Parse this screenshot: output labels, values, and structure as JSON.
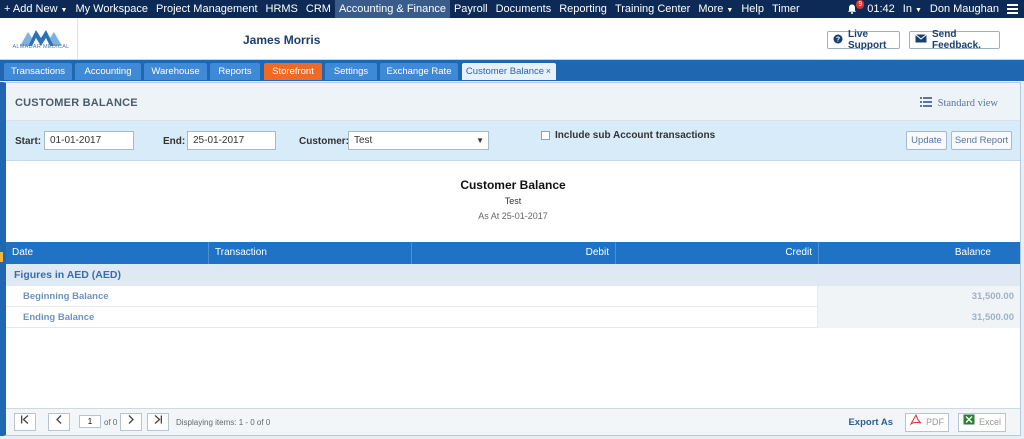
{
  "topnav": {
    "items": [
      "+ Add New",
      "My Workspace",
      "Project Management",
      "HRMS",
      "CRM",
      "Accounting & Finance",
      "Payroll",
      "Documents",
      "Reporting",
      "Training Center",
      "More",
      "Help",
      "Timer"
    ],
    "notification_count": "9",
    "time": "01:42",
    "status": "In",
    "user": "Don Maughan"
  },
  "header": {
    "logo_text": "ALMADAR MEDICAL",
    "user_name": "James Morris",
    "live_support": "Live Support",
    "send_feedback": "Send Feedback."
  },
  "tabs": [
    {
      "label": "Transactions"
    },
    {
      "label": "Accounting"
    },
    {
      "label": "Warehouse"
    },
    {
      "label": "Reports"
    },
    {
      "label": "Storefront"
    },
    {
      "label": "Settings"
    },
    {
      "label": "Exchange Rate"
    },
    {
      "label": "Customer Balance",
      "close": "×"
    }
  ],
  "page": {
    "title": "CUSTOMER BALANCE",
    "standard_view": "Standard view"
  },
  "filter": {
    "start_label": "Start:",
    "start_value": "01-01-2017",
    "end_label": "End:",
    "end_value": "25-01-2017",
    "customer_label": "Customer:",
    "customer_value": "Test",
    "sub_account_label": "Include sub Account transactions",
    "update": "Update",
    "send_report": "Send Report"
  },
  "report": {
    "title": "Customer Balance",
    "customer": "Test",
    "as_at": "As At 25-01-2017"
  },
  "grid": {
    "columns": [
      "Date",
      "Transaction",
      "Debit",
      "Credit",
      "Balance"
    ],
    "group": "Figures in AED (AED)",
    "rows": [
      {
        "label": "Beginning Balance",
        "balance": "31,500.00"
      },
      {
        "label": "Ending Balance",
        "balance": "31,500.00"
      }
    ]
  },
  "footer": {
    "page_value": "1",
    "of_text": "of 0",
    "displaying": "Displaying items: 1 - 0 of 0",
    "export_as": "Export As",
    "pdf": "PDF",
    "excel": "Excel"
  }
}
